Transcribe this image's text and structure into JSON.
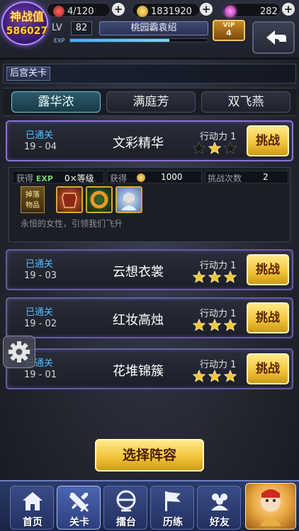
{
  "status_bar": {
    "power_title": "神战值",
    "power_value": "586027",
    "stamina": "4/120",
    "coins": "1831920",
    "gems": "282",
    "level_label": "LV",
    "level": "82",
    "player_title": "桃园霸袁绍",
    "exp_label": "EXP",
    "exp_progress": 0.72,
    "vip_label": "VIP",
    "vip_level": "4"
  },
  "header": {
    "section_title": "后宫关卡"
  },
  "tabs": [
    {
      "label": "露华浓",
      "active": true
    },
    {
      "label": "满庭芳",
      "active": false
    },
    {
      "label": "双飞燕",
      "active": false
    }
  ],
  "stages": [
    {
      "status": "已通关",
      "number": "19 - 04",
      "name": "文彩精华",
      "stamina": "行动力 1",
      "stars_earned": 1,
      "stars_total": 3,
      "button": "挑战"
    },
    {
      "status": "已通关",
      "number": "19 - 03",
      "name": "云想衣裳",
      "stamina": "行动力 1",
      "stars_earned": 3,
      "stars_total": 3,
      "button": "挑战"
    },
    {
      "status": "已通关",
      "number": "19 - 02",
      "name": "红妆高烛",
      "stamina": "行动力 1",
      "stars_earned": 3,
      "stars_total": 3,
      "button": "挑战"
    },
    {
      "status": "已通关",
      "number": "19 - 01",
      "name": "花堆锦簇",
      "stamina": "行动力 1",
      "stars_earned": 3,
      "stars_total": 3,
      "button": "挑战"
    }
  ],
  "detail": {
    "exp_reward_label": "获得",
    "exp_icon": "EXP",
    "exp_reward_value": "0×等级",
    "coin_reward_label": "获得",
    "coin_reward_value": "1000",
    "attempts_label": "挑战次数",
    "attempts_value": "2",
    "drop_tag": "掉落",
    "drop_tag_sub": "物品",
    "description": "永恒的女性，引领我们飞升"
  },
  "select_button": "选择阵容",
  "bottom_nav": [
    {
      "label": "首页",
      "icon": "home-icon",
      "active": false
    },
    {
      "label": "关卡",
      "icon": "swords-icon",
      "active": true
    },
    {
      "label": "擂台",
      "icon": "arena-icon",
      "active": false
    },
    {
      "label": "历练",
      "icon": "flag-icon",
      "active": false
    },
    {
      "label": "好友",
      "icon": "friends-icon",
      "active": false
    }
  ],
  "colors": {
    "star_gold": "#f3c633",
    "star_empty": "#1a1a1a",
    "cleared_blue": "#4fc0ff",
    "button_gold": "#f1c63c"
  }
}
